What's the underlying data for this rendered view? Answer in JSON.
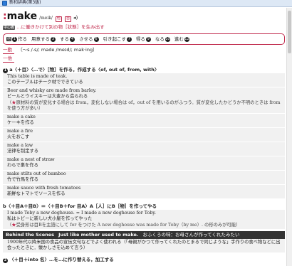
{
  "window": {
    "title": "新和辞典(第3版)"
  },
  "entry": {
    "headword": "make",
    "pron": "/meɪk/",
    "pos_tags": [
      "他",
      "自"
    ],
    "core_tag": "中心義",
    "core_meaning": "…に働きかけて別の物［状態］を生み出す",
    "forms": [
      {
        "num": "他",
        "label": "作る",
        "n": "1"
      },
      {
        "label": "用意する",
        "n": "3"
      },
      {
        "label": "する",
        "n": "4"
      },
      {
        "label": "させる",
        "n": "6"
      },
      {
        "label": "引き起こす",
        "n": "7"
      },
      {
        "label": "得る",
        "n": "9"
      },
      {
        "label": "なる",
        "n": "10"
      },
      {
        "label": "進む",
        "n": "12"
      }
    ],
    "line1_label": "一動",
    "line1_text": "〔～s /-s/; made /meɪd/; mak·ing〕",
    "line2_label": "一他"
  },
  "sense1": {
    "num": "1",
    "text": "a〈＋目〉〈…で〉［物］を作る，作成する〈of, out of, from, with〉",
    "examples": [
      {
        "en": "This table is made of teak.",
        "ja": "このテーブルはチーク材でできている"
      },
      {
        "en": "Beer and whisky are made from barley.",
        "ja": "ビールとウイスキーは大麦から造られる",
        "note": "原材料の質が変化する場合は from，変化しない場合は of，out of を用いるのがふつう．質が変化したかどうか不明のときは from を使う方が多い"
      },
      {
        "en": "make a cake",
        "ja": "ケーキを作る"
      },
      {
        "en": "make a fire",
        "ja": "火をおこす"
      },
      {
        "en": "make a law",
        "ja": "法律を制定する"
      },
      {
        "en": "make a nest of straw",
        "ja": "わらで巣を作る"
      },
      {
        "en": "make stilts out of bamboo",
        "ja": "竹で竹馬を作る"
      },
      {
        "en": "make sauce with fresh tomatoes",
        "ja": "新鮮なトマトでソースを作る"
      }
    ]
  },
  "sense1b": {
    "text": "b〈＋目A＋目B〉＝〈＋目B＋for 目A〉A［人］にB［物］を作ってやる",
    "examples": [
      {
        "en": "I made Toby a new doghouse. = I made a new doghouse for Toby.",
        "ja": "私はトビーに新しい犬小屋を作ってやった",
        "note": "受身形は目Bを主語にして for をつけた A new doghouse was made for Toby（by me）. の形のみが可能"
      }
    ]
  },
  "behind": {
    "label": "Behind the Scenes",
    "quote": "Just like mother used to make.",
    "quote_ja": "おふくろの味：お母さんが作ってくれたみたい",
    "body": "1900年代以降米国の食品の宣伝文句などでよく使われる（「母親がかつて作ってくれたのとまるで同じような」手作りの食べ物などに出会ったときに．懐かしさを込めて言う）"
  },
  "sense2": {
    "num": "2",
    "text": "〈＋目＋into 名〉…を…に作り替える，加工する"
  }
}
